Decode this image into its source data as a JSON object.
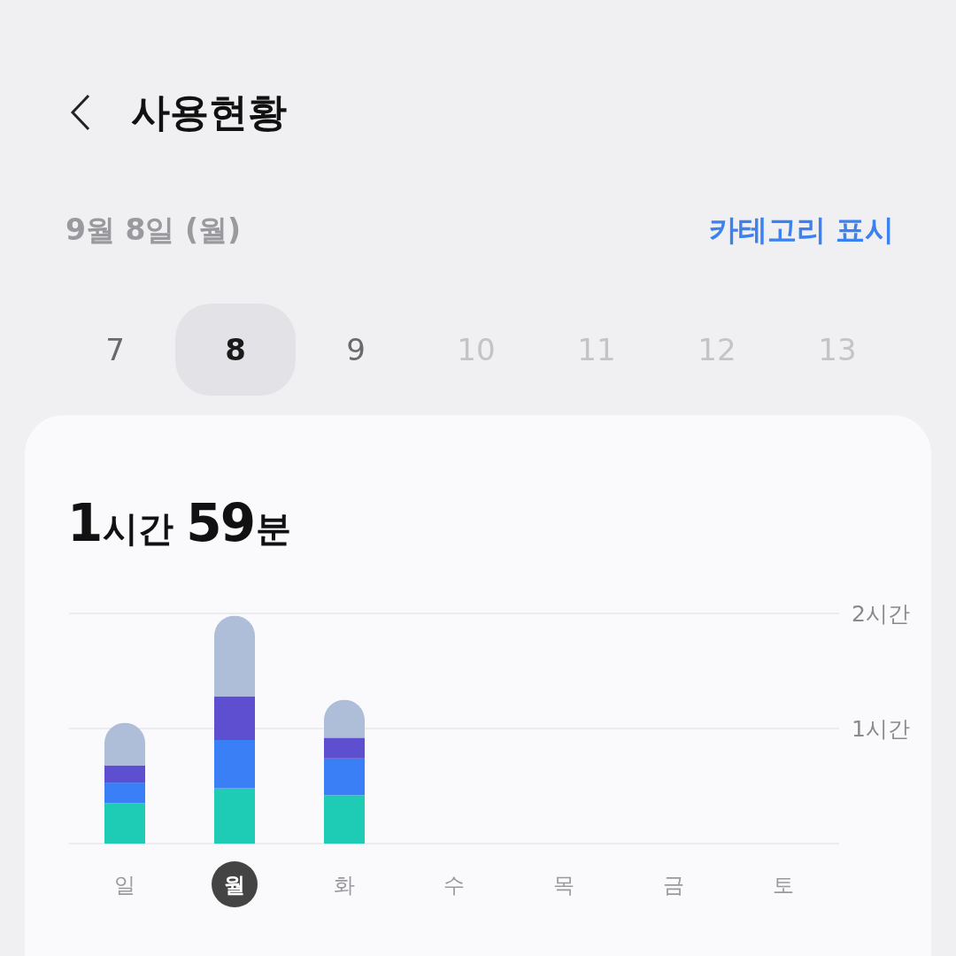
{
  "header": {
    "title": "사용현황"
  },
  "date_row": {
    "date": "9월 8일 (월)",
    "link": "카테고리 표시"
  },
  "days": [
    {
      "label": "7",
      "selected": false,
      "disabled": false
    },
    {
      "label": "8",
      "selected": true,
      "disabled": false
    },
    {
      "label": "9",
      "selected": false,
      "disabled": false
    },
    {
      "label": "10",
      "selected": false,
      "disabled": true
    },
    {
      "label": "11",
      "selected": false,
      "disabled": true
    },
    {
      "label": "12",
      "selected": false,
      "disabled": true
    },
    {
      "label": "13",
      "selected": false,
      "disabled": true
    }
  ],
  "card": {
    "total": [
      {
        "number": "1",
        "unit": "시간"
      },
      {
        "number": "59",
        "unit": "분"
      }
    ],
    "weekdays": [
      {
        "selected": false
      },
      {
        "selected": true
      },
      {
        "selected": false
      },
      {
        "selected": false
      },
      {
        "selected": false
      },
      {
        "selected": false
      },
      {
        "selected": false
      }
    ],
    "chart_data": {
      "type": "bar",
      "stacked": true,
      "categories": [
        "일",
        "월",
        "화",
        "수",
        "목",
        "금",
        "토"
      ],
      "ylim": [
        0,
        2
      ],
      "yticks": [
        {
          "value": 1,
          "label": "1시간"
        },
        {
          "value": 2,
          "label": "2시간"
        }
      ],
      "series": [
        {
          "color": "#1ecbb4",
          "values": [
            0.35,
            0.48,
            0.42,
            null,
            null,
            null,
            null
          ]
        },
        {
          "color": "#3a7ff6",
          "values": [
            0.18,
            0.42,
            0.32,
            null,
            null,
            null,
            null
          ]
        },
        {
          "color": "#5e4fd0",
          "values": [
            0.15,
            0.38,
            0.18,
            null,
            null,
            null,
            null
          ]
        },
        {
          "color": "#aebdd8",
          "values": [
            0.37,
            0.7,
            0.33,
            null,
            null,
            null,
            null
          ]
        }
      ]
    }
  }
}
